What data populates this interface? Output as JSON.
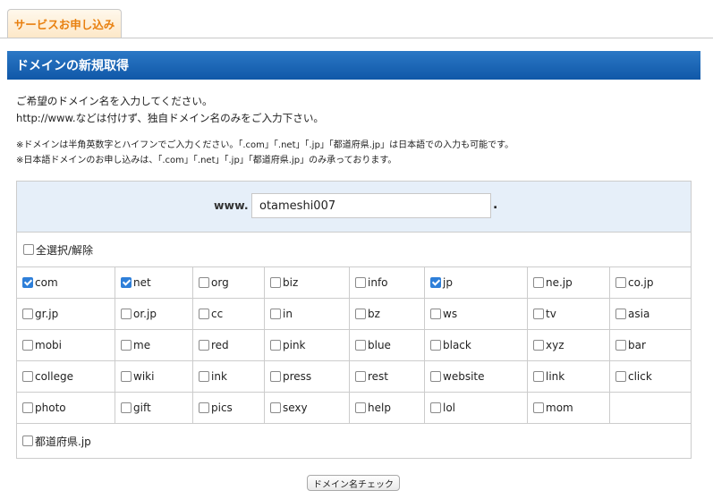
{
  "tab": {
    "label": "サービスお申し込み"
  },
  "section_title": "ドメインの新規取得",
  "intro": {
    "line1": "ご希望のドメイン名を入力してください。",
    "line2": "http://www.などは付けず、独自ドメイン名のみをご入力下さい。"
  },
  "notes": {
    "line1": "※ドメインは半角英数字とハイフンでご入力ください。「.com」「.net」「.jp」「都道府県.jp」は日本語での入力も可能です。",
    "line2": "※日本語ドメインのお申し込みは、「.com」「.net」「.jp」「都道府県.jp」のみ承っております。"
  },
  "domain_input": {
    "prefix": "www.",
    "value": "otameshi007",
    "suffix": "."
  },
  "select_all": {
    "label": "全選択/解除",
    "checked": false
  },
  "tlds": [
    {
      "label": "com",
      "checked": true
    },
    {
      "label": "net",
      "checked": true
    },
    {
      "label": "org",
      "checked": false
    },
    {
      "label": "biz",
      "checked": false
    },
    {
      "label": "info",
      "checked": false
    },
    {
      "label": "jp",
      "checked": true
    },
    {
      "label": "ne.jp",
      "checked": false
    },
    {
      "label": "co.jp",
      "checked": false
    },
    {
      "label": "gr.jp",
      "checked": false
    },
    {
      "label": "or.jp",
      "checked": false
    },
    {
      "label": "cc",
      "checked": false
    },
    {
      "label": "in",
      "checked": false
    },
    {
      "label": "bz",
      "checked": false
    },
    {
      "label": "ws",
      "checked": false
    },
    {
      "label": "tv",
      "checked": false
    },
    {
      "label": "asia",
      "checked": false
    },
    {
      "label": "mobi",
      "checked": false
    },
    {
      "label": "me",
      "checked": false
    },
    {
      "label": "red",
      "checked": false
    },
    {
      "label": "pink",
      "checked": false
    },
    {
      "label": "blue",
      "checked": false
    },
    {
      "label": "black",
      "checked": false
    },
    {
      "label": "xyz",
      "checked": false
    },
    {
      "label": "bar",
      "checked": false
    },
    {
      "label": "college",
      "checked": false
    },
    {
      "label": "wiki",
      "checked": false
    },
    {
      "label": "ink",
      "checked": false
    },
    {
      "label": "press",
      "checked": false
    },
    {
      "label": "rest",
      "checked": false
    },
    {
      "label": "website",
      "checked": false
    },
    {
      "label": "link",
      "checked": false
    },
    {
      "label": "click",
      "checked": false
    },
    {
      "label": "photo",
      "checked": false
    },
    {
      "label": "gift",
      "checked": false
    },
    {
      "label": "pics",
      "checked": false
    },
    {
      "label": "sexy",
      "checked": false
    },
    {
      "label": "help",
      "checked": false
    },
    {
      "label": "lol",
      "checked": false
    },
    {
      "label": "mom",
      "checked": false
    }
  ],
  "prefecture": {
    "label": "都道府県.jp",
    "checked": false
  },
  "check_button": {
    "label": "ドメイン名チェック"
  },
  "colors": {
    "tab_text": "#e8800f",
    "title_bar": "#1a66b5",
    "domain_row_bg": "#e6eff9",
    "checkbox_checked": "#2e7fd9"
  }
}
